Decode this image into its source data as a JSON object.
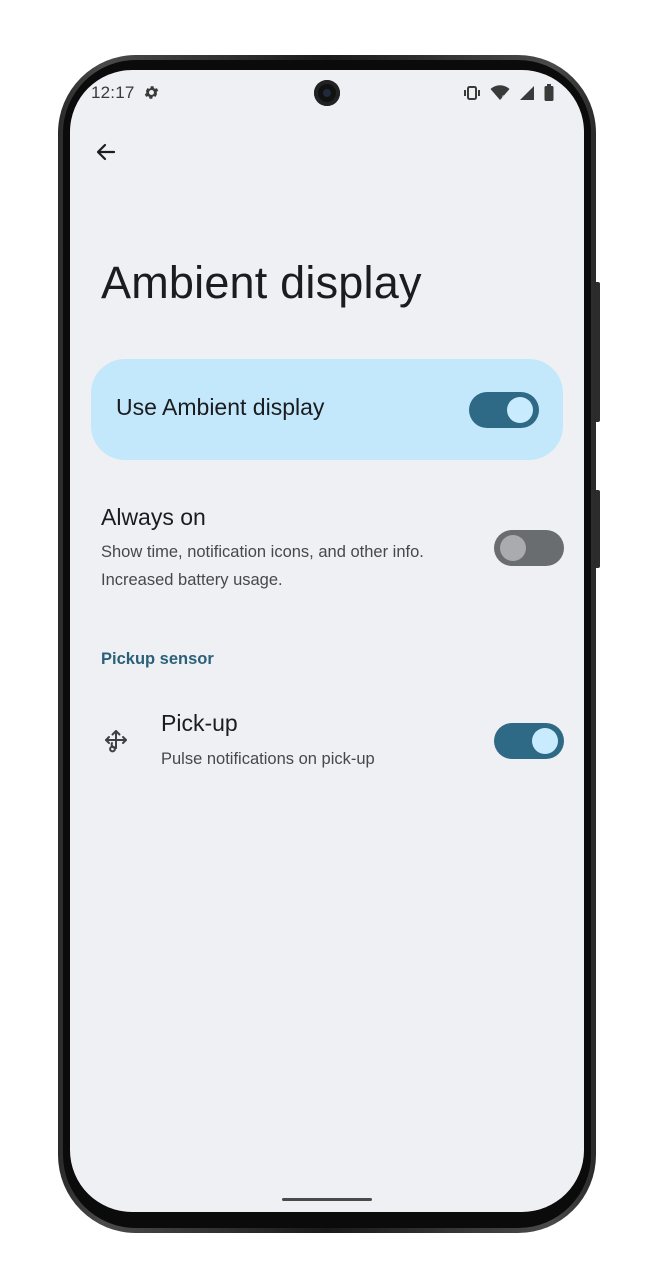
{
  "status_bar": {
    "time": "12:17",
    "left_icons": [
      "gear-icon"
    ],
    "right_icons": [
      "vibrate-icon",
      "wifi-icon",
      "cell-signal-icon",
      "battery-icon"
    ]
  },
  "header": {
    "back_icon": "arrow-left-icon",
    "title": "Ambient display"
  },
  "main_toggle": {
    "label": "Use Ambient display",
    "checked": true
  },
  "always_on": {
    "title": "Always on",
    "summary": "Show time, notification icons, and other info. Increased battery usage.",
    "checked": false
  },
  "section": {
    "header": "Pickup sensor"
  },
  "pickup": {
    "icon": "pickup-gesture-icon",
    "title": "Pick-up",
    "summary": "Pulse notifications on pick-up",
    "checked": true
  },
  "colors": {
    "screen_bg": "#eff0f3",
    "card_bg": "#c3e8fb",
    "switch_on_track": "#2e6a86",
    "switch_on_thumb": "#c8ecfd",
    "switch_off_track": "#6a6d70",
    "switch_off_thumb": "#a9abae",
    "section_header": "#2a6179"
  }
}
